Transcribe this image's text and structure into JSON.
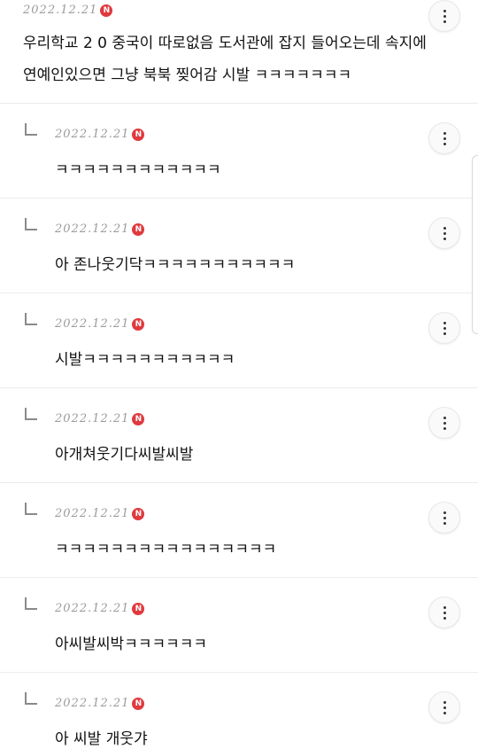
{
  "badge_letter": "N",
  "main_post": {
    "date": "2022.12.21",
    "lines": [
      "우리학교 2 0 중국이 따로없음 도서관에 잡지 들어오는데 속지에",
      "연예인있으면 그냥 북북 찢어감 시발 ㅋㅋㅋㅋㅋㅋㅋ"
    ]
  },
  "replies": [
    {
      "date": "2022.12.21",
      "text": "ㅋㅋㅋㅋㅋㅋㅋㅋㅋㅋㅋㅋ"
    },
    {
      "date": "2022.12.21",
      "text": "아 존나웃기닥ㅋㅋㅋㅋㅋㅋㅋㅋㅋㅋㅋ"
    },
    {
      "date": "2022.12.21",
      "text": "시발ㅋㅋㅋㅋㅋㅋㅋㅋㅋㅋㅋ"
    },
    {
      "date": "2022.12.21",
      "text": "아개쳐웃기다씨발씨발"
    },
    {
      "date": "2022.12.21",
      "text": "ㅋㅋㅋㅋㅋㅋㅋㅋㅋㅋㅋㅋㅋㅋㅋㅋ"
    },
    {
      "date": "2022.12.21",
      "text": "아씨발씨박ㅋㅋㅋㅋㅋㅋ"
    },
    {
      "date": "2022.12.21",
      "text": "아 씨발 개웃갸"
    }
  ]
}
